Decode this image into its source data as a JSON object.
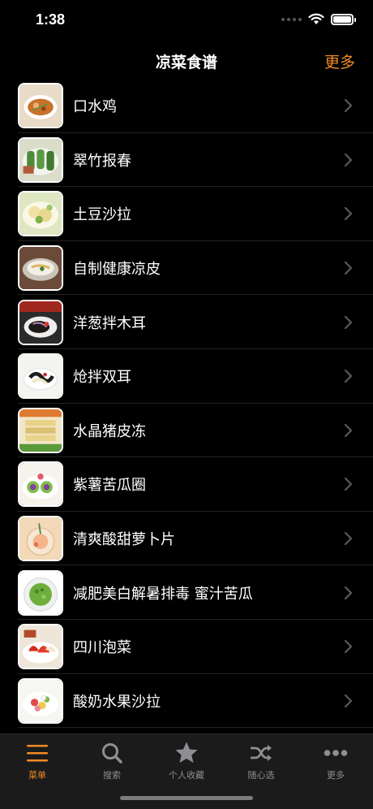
{
  "status": {
    "time": "1:38"
  },
  "nav": {
    "title": "凉菜食谱",
    "more_label": "更多"
  },
  "accent_color": "#f08a24",
  "recipes": [
    {
      "name": "口水鸡",
      "thumb_icon": "spicy-chicken-photo"
    },
    {
      "name": "翠竹报春",
      "thumb_icon": "green-rolls-photo"
    },
    {
      "name": "土豆沙拉",
      "thumb_icon": "potato-salad-photo"
    },
    {
      "name": "自制健康凉皮",
      "thumb_icon": "liangpi-photo"
    },
    {
      "name": "洋葱拌木耳",
      "thumb_icon": "onion-fungus-photo"
    },
    {
      "name": "炝拌双耳",
      "thumb_icon": "double-fungus-photo"
    },
    {
      "name": "水晶猪皮冻",
      "thumb_icon": "pork-jelly-photo"
    },
    {
      "name": "紫薯苦瓜圈",
      "thumb_icon": "purple-potato-bitter-melon-photo"
    },
    {
      "name": "清爽酸甜萝卜片",
      "thumb_icon": "radish-slices-photo"
    },
    {
      "name": "减肥美白解暑排毒 蜜汁苦瓜",
      "thumb_icon": "honey-bitter-melon-photo"
    },
    {
      "name": "四川泡菜",
      "thumb_icon": "sichuan-pickles-photo"
    },
    {
      "name": "酸奶水果沙拉",
      "thumb_icon": "yogurt-fruit-salad-photo"
    }
  ],
  "tabs": [
    {
      "label": "菜单",
      "icon": "menu-icon",
      "active": true
    },
    {
      "label": "搜索",
      "icon": "search-icon",
      "active": false
    },
    {
      "label": "个人收藏",
      "icon": "star-icon",
      "active": false
    },
    {
      "label": "随心选",
      "icon": "shuffle-icon",
      "active": false
    },
    {
      "label": "更多",
      "icon": "more-icon",
      "active": false
    }
  ]
}
